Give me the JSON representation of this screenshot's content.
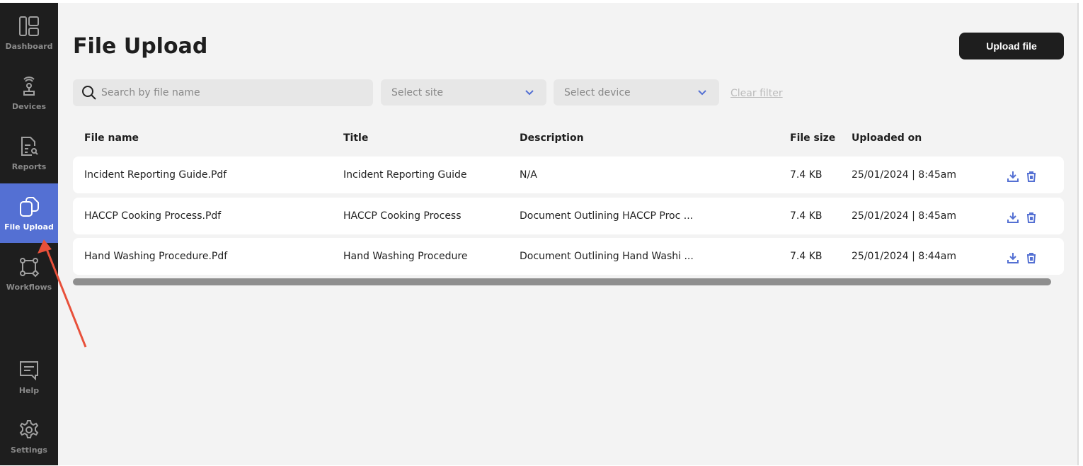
{
  "sidebar": {
    "items": [
      {
        "label": "Dashboard",
        "icon": "dashboard-icon"
      },
      {
        "label": "Devices",
        "icon": "device-icon"
      },
      {
        "label": "Reports",
        "icon": "report-icon"
      },
      {
        "label": "File Upload",
        "icon": "files-icon",
        "active": true
      },
      {
        "label": "Workflows",
        "icon": "workflow-icon"
      },
      {
        "label": "Help",
        "icon": "chat-icon"
      },
      {
        "label": "Settings",
        "icon": "gear-icon"
      }
    ]
  },
  "header": {
    "title": "File Upload",
    "upload_label": "Upload file"
  },
  "filters": {
    "search_placeholder": "Search by file name",
    "site_placeholder": "Select site",
    "device_placeholder": "Select device",
    "clear_label": "Clear filter"
  },
  "table": {
    "columns": [
      "File name",
      "Title",
      "Description",
      "File size",
      "Uploaded on"
    ],
    "rows": [
      {
        "file": "Incident Reporting Guide.Pdf",
        "title": "Incident Reporting Guide",
        "desc": "N/A",
        "size": "7.4 KB",
        "date": "25/01/2024 | 8:45am"
      },
      {
        "file": "HACCP Cooking Process.Pdf",
        "title": "HACCP Cooking Process",
        "desc": "Document Outlining HACCP Proc ...",
        "size": "7.4 KB",
        "date": "25/01/2024 | 8:45am"
      },
      {
        "file": "Hand Washing Procedure.Pdf",
        "title": "Hand Washing Procedure",
        "desc": "Document Outlining Hand Washi ...",
        "size": "7.4 KB",
        "date": "25/01/2024 | 8:44am"
      }
    ]
  },
  "colors": {
    "accent": "#5470d3",
    "sidebar": "#1e1e1e",
    "annotation": "#e8503a"
  }
}
